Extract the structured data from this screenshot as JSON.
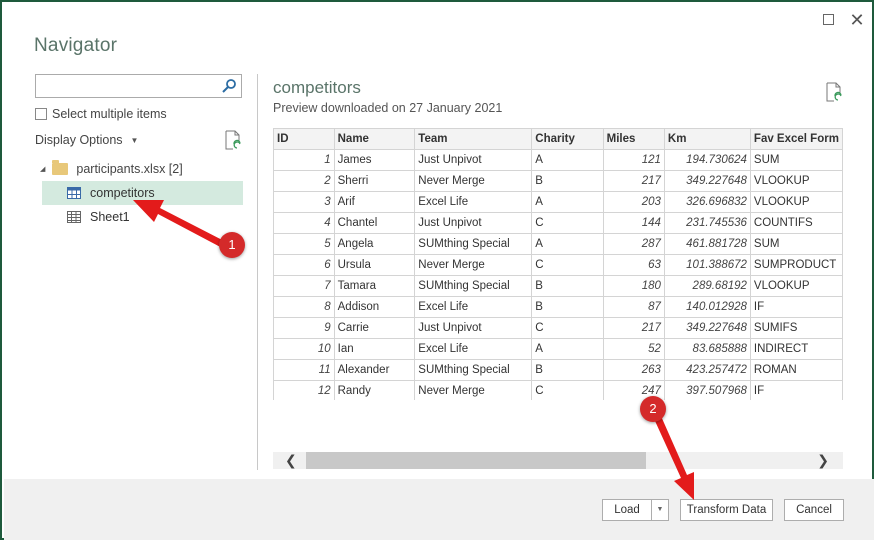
{
  "window": {
    "title": "Navigator",
    "maximize_icon": "maximize-icon",
    "close_icon": "close-icon",
    "close_glyph": "✕"
  },
  "left_panel": {
    "search": {
      "value": "",
      "placeholder": ""
    },
    "select_multiple_label": "Select multiple items",
    "select_multiple_checked": false,
    "display_options_label": "Display Options",
    "display_options_caret": "▼",
    "tree": {
      "root": {
        "label": "participants.xlsx [2]",
        "expand_glyph": "◢",
        "icon": "folder-icon"
      },
      "items": [
        {
          "label": "competitors",
          "icon": "table-icon",
          "selected": true
        },
        {
          "label": "Sheet1",
          "icon": "sheet-icon",
          "selected": false
        }
      ]
    }
  },
  "preview": {
    "title": "competitors",
    "subtitle": "Preview downloaded on 27 January 2021",
    "columns": [
      "ID",
      "Name",
      "Team",
      "Charity",
      "Miles",
      "Km",
      "Fav Excel Form"
    ],
    "rows": [
      [
        "1",
        "James",
        "Just Unpivot",
        "A",
        "121",
        "194.730624",
        "SUM"
      ],
      [
        "2",
        "Sherri",
        "Never Merge",
        "B",
        "217",
        "349.227648",
        "VLOOKUP"
      ],
      [
        "3",
        "Arif",
        "Excel Life",
        "A",
        "203",
        "326.696832",
        "VLOOKUP"
      ],
      [
        "4",
        "Chantel",
        "Just Unpivot",
        "C",
        "144",
        "231.745536",
        "COUNTIFS"
      ],
      [
        "5",
        "Angela",
        "SUMthing Special",
        "A",
        "287",
        "461.881728",
        "SUM"
      ],
      [
        "6",
        "Ursula",
        "Never Merge",
        "C",
        "63",
        "101.388672",
        "SUMPRODUCT"
      ],
      [
        "7",
        "Tamara",
        "SUMthing Special",
        "B",
        "180",
        "289.68192",
        "VLOOKUP"
      ],
      [
        "8",
        "Addison",
        "Excel Life",
        "B",
        "87",
        "140.012928",
        "IF"
      ],
      [
        "9",
        "Carrie",
        "Just Unpivot",
        "C",
        "217",
        "349.227648",
        "SUMIFS"
      ],
      [
        "10",
        "Ian",
        "Excel Life",
        "A",
        "52",
        "83.685888",
        "INDIRECT"
      ],
      [
        "11",
        "Alexander",
        "SUMthing Special",
        "B",
        "263",
        "423.257472",
        "ROMAN"
      ],
      [
        "12",
        "Randy",
        "Never Merge",
        "C",
        "247",
        "397.507968",
        "IF"
      ]
    ],
    "scroll": {
      "left_glyph": "❮",
      "right_glyph": "❯"
    }
  },
  "footer": {
    "load_label": "Load",
    "load_dropdown_glyph": "▼",
    "transform_label": "Transform Data",
    "cancel_label": "Cancel"
  },
  "annotations": {
    "badge_1": "1",
    "badge_2": "2",
    "color": "#e31b1b"
  }
}
